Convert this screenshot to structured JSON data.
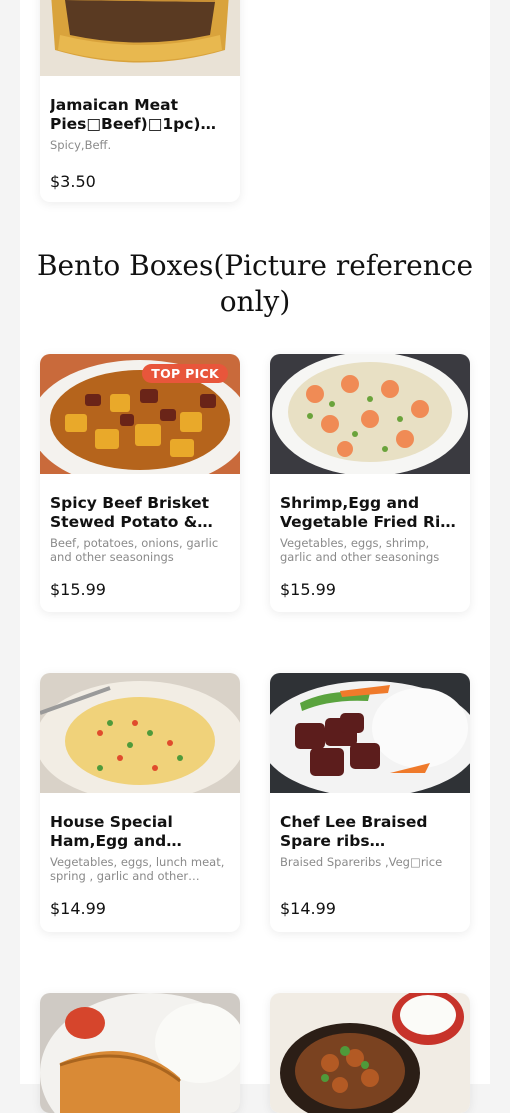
{
  "top_item": {
    "name": "Jamaican Meat Pies□Beef)□1pc) □□□□□",
    "desc": "Spicy,Beff.",
    "price": "$3.50"
  },
  "section": {
    "title": "Bento Boxes(Picture reference only)"
  },
  "items": [
    {
      "name": "Spicy Beef Brisket Stewed Potato & Rice…",
      "desc": "Beef, potatoes, onions, garlic and other seasonings",
      "price": "$15.99",
      "badge": "TOP PICK"
    },
    {
      "name": "Shrimp,Egg and Vegetable Fried Rice …",
      "desc": "Vegetables, eggs, shrimp, garlic and other seasonings",
      "price": "$15.99"
    },
    {
      "name": "House Special Ham,Egg and…",
      "desc": "Vegetables, eggs, lunch meat, spring , garlic and other…",
      "price": "$14.99"
    },
    {
      "name": "Chef Lee Braised Spare ribs w/Veggies And…",
      "desc": "Braised Spareribs ,Veg□rice",
      "price": "$14.99"
    },
    {},
    {}
  ],
  "icons": {
    "meat-pie-photo": "food-photo",
    "beef-potato-photo": "food-photo",
    "shrimp-fried-rice-photo": "food-photo",
    "ham-egg-fried-rice-photo": "food-photo",
    "braised-ribs-photo": "food-photo"
  }
}
